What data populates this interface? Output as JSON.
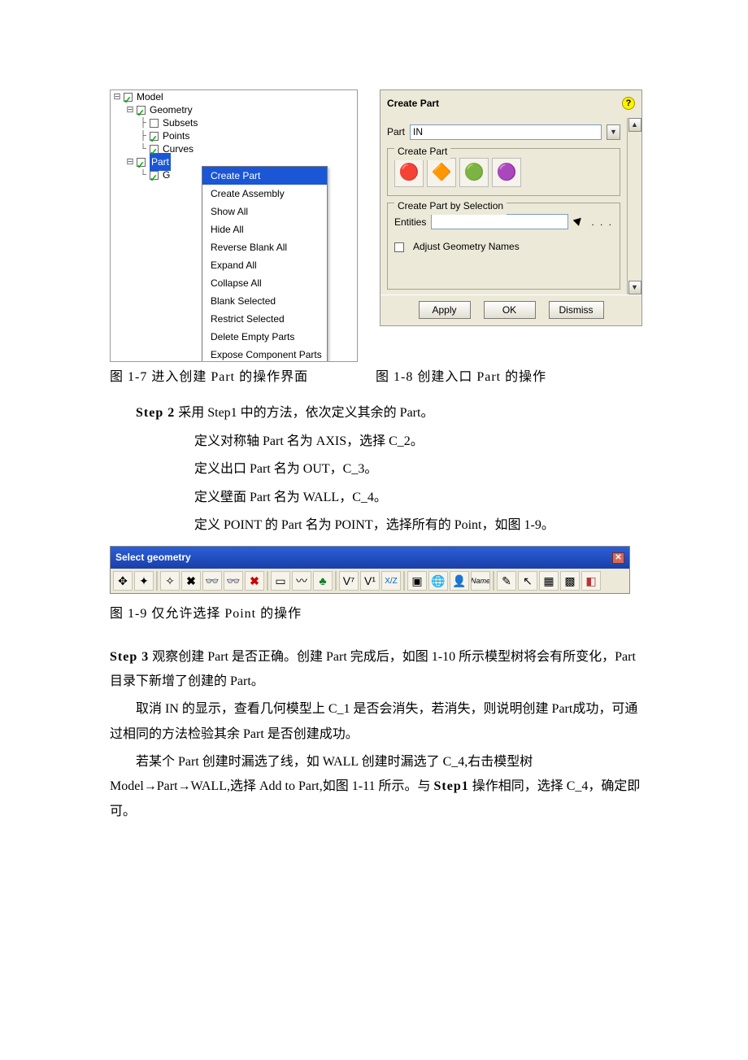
{
  "tree": {
    "model": "Model",
    "geometry": "Geometry",
    "subsets": "Subsets",
    "points": "Points",
    "curves": "Curves",
    "parts": "Part",
    "g_child": "G"
  },
  "context_menu": {
    "items": [
      "Create Part",
      "Create Assembly",
      "Show All",
      "Hide All",
      "Reverse Blank All",
      "Expand All",
      "Collapse All",
      "Blank Selected",
      "Restrict Selected",
      "Delete Empty Parts",
      "Expose Component Parts"
    ]
  },
  "create_panel": {
    "title": "Create Part",
    "part_label": "Part",
    "part_value": "IN",
    "group1": "Create Part",
    "group2": "Create Part by Selection",
    "entities_label": "Entities",
    "entities_value": "",
    "dots": ". . .",
    "adjust_label": "Adjust Geometry Names",
    "buttons": {
      "apply": "Apply",
      "ok": "OK",
      "dismiss": "Dismiss"
    }
  },
  "captions": {
    "c17": "图 1-7   进入创建 Part 的操作界面",
    "c18": "图 1-8    创建入口 Part 的操作",
    "c19": "图 1-9          仅允许选择 Point 的操作"
  },
  "text": {
    "step2_label": "Step 2",
    "step2_rest": " 采用 Step1 中的方法，依次定义其余的 Part。",
    "s2_l1": "定义对称轴 Part 名为 AXIS，选择 C_2。",
    "s2_l2": "定义出口 Part 名为 OUT，C_3。",
    "s2_l3": "定义壁面 Part 名为 WALL，C_4。",
    "s2_l4": "定义 POINT 的 Part 名为 POINT，选择所有的 Point，如图 1-9。",
    "step3_label": "Step 3",
    "step3_rest": " 观察创建 Part 是否正确。创建 Part 完成后，如图 1-10 所示模型树将会有所变化，Part 目录下新增了创建的 Part。",
    "p3a": "取消 IN 的显示，查看几何模型上 C_1 是否会消失，若消失，则说明创建 Part成功，可通过相同的方法检验其余 Part 是否创建成功。",
    "p3b_a": "若某个 Part 创建时漏选了线，如 WALL 创建时漏选了 C_4,右击模型树 Model→Part→WALL,选择 Add to Part,如图 1-11 所示。与 ",
    "p3b_step1": "Step1",
    "p3b_b": " 操作相同，选择 C_4，确定即可。"
  },
  "select_toolbar": {
    "title": "Select geometry",
    "icons": [
      "select-icon",
      "pan-icon",
      "star-icon",
      "x-bold-icon",
      "glasses-icon",
      "glasses2-icon",
      "x-red-icon",
      "rect-icon",
      "lasso-icon",
      "leaf-icon",
      "volume7-icon",
      "volume1-icon",
      "xyz-icon",
      "box-icon",
      "globe-icon",
      "person-icon",
      "name-icon",
      "curve-icon",
      "arrow-sel-icon",
      "hatch-icon",
      "hatch2-icon",
      "cube-icon"
    ]
  }
}
